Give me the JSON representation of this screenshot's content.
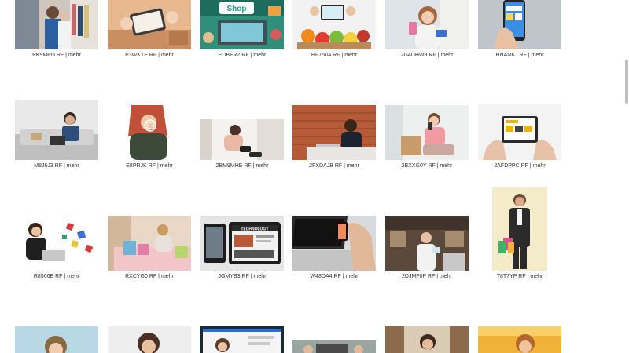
{
  "rows": [
    [
      {
        "code": "PK9MPD",
        "license": "RF",
        "link": "mehr"
      },
      {
        "code": "P3WKTE",
        "license": "RF",
        "link": "mehr"
      },
      {
        "code": "EDBFR2",
        "license": "RF",
        "link": "mehr"
      },
      {
        "code": "HF750A",
        "license": "RF",
        "link": "mehr"
      },
      {
        "code": "2G4DHW9",
        "license": "RF",
        "link": "mehr"
      },
      {
        "code": "HNANKJ",
        "license": "RF",
        "link": "mehr"
      }
    ],
    [
      {
        "code": "M8J6J3",
        "license": "RF",
        "link": "mehr"
      },
      {
        "code": "E8PRJK",
        "license": "RF",
        "link": "mehr"
      },
      {
        "code": "2BM9MHE",
        "license": "RF",
        "link": "mehr"
      },
      {
        "code": "2FXDAJB",
        "license": "RF",
        "link": "mehr"
      },
      {
        "code": "2BXXG0Y",
        "license": "RF",
        "link": "mehr"
      },
      {
        "code": "2AFDPPC",
        "license": "RF",
        "link": "mehr"
      }
    ],
    [
      {
        "code": "R8566E",
        "license": "RF",
        "link": "mehr"
      },
      {
        "code": "RXCYG0",
        "license": "RF",
        "link": "mehr"
      },
      {
        "code": "JGMYB3",
        "license": "RF",
        "link": "mehr"
      },
      {
        "code": "W48DA4",
        "license": "RF",
        "link": "mehr"
      },
      {
        "code": "2DJMF0P",
        "license": "RF",
        "link": "mehr"
      },
      {
        "code": "T8T7YP",
        "license": "RF",
        "link": "mehr"
      }
    ],
    [
      {},
      {},
      {},
      {},
      {},
      {}
    ]
  ],
  "thumb_text": {
    "shop_sign": "Shop",
    "tablet_banner": "TECHNOLOGY"
  }
}
